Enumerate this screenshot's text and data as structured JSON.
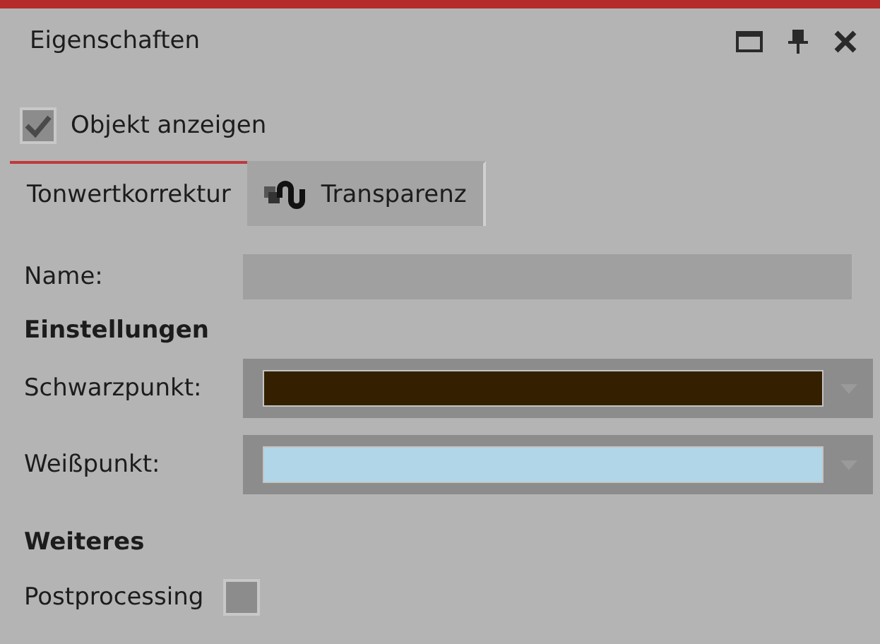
{
  "window": {
    "title": "Eigenschaften"
  },
  "show_object": {
    "label": "Objekt anzeigen",
    "checked": true
  },
  "tabs": [
    {
      "label": "Tonwertkorrektur",
      "selected": true,
      "kind": "plain"
    },
    {
      "label": "Transparenz",
      "selected": false,
      "kind": "icon"
    }
  ],
  "name_field": {
    "label": "Name:"
  },
  "settings": {
    "heading": "Einstellungen",
    "color_pickers": [
      {
        "label": "Schwarzpunkt:",
        "color": "#342000"
      },
      {
        "label": "Weißpunkt:",
        "color": "#b0d6e8"
      }
    ]
  },
  "more": {
    "heading": "Weiteres",
    "postprocessing": {
      "label": "Postprocessing",
      "checked": false
    }
  }
}
